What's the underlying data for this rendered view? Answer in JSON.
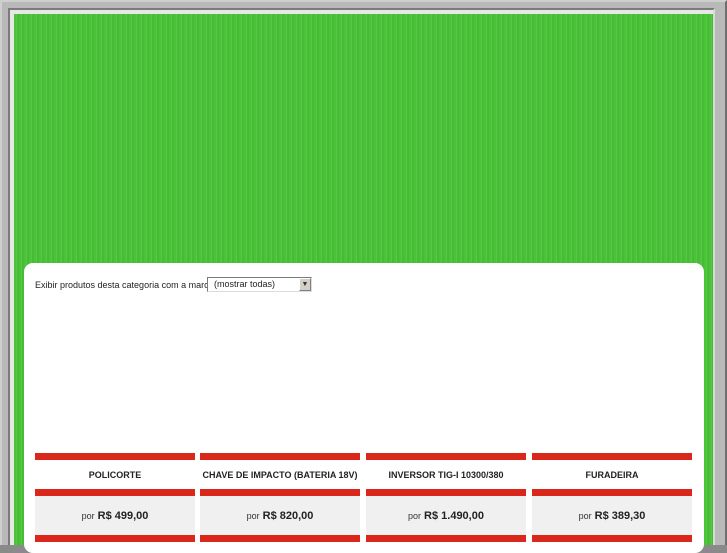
{
  "filter": {
    "label": "Exibir produtos desta categoria com a marca:",
    "selected": "(mostrar todas)",
    "arrow": "▼"
  },
  "products": [
    {
      "name": "POLICORTE",
      "price_prefix": "por",
      "price": "R$ 499,00"
    },
    {
      "name": "CHAVE DE IMPACTO (BATERIA 18V)",
      "price_prefix": "por",
      "price": "R$ 820,00"
    },
    {
      "name": "INVERSOR TIG-I 10300/380",
      "price_prefix": "por",
      "price": "R$ 1.490,00"
    },
    {
      "name": "FURADEIRA",
      "price_prefix": "por",
      "price": "R$ 389,30"
    }
  ],
  "colors": {
    "banner": "#4cc23a",
    "accent_bar": "#d9271c",
    "price_bg": "#f0f0f0"
  }
}
